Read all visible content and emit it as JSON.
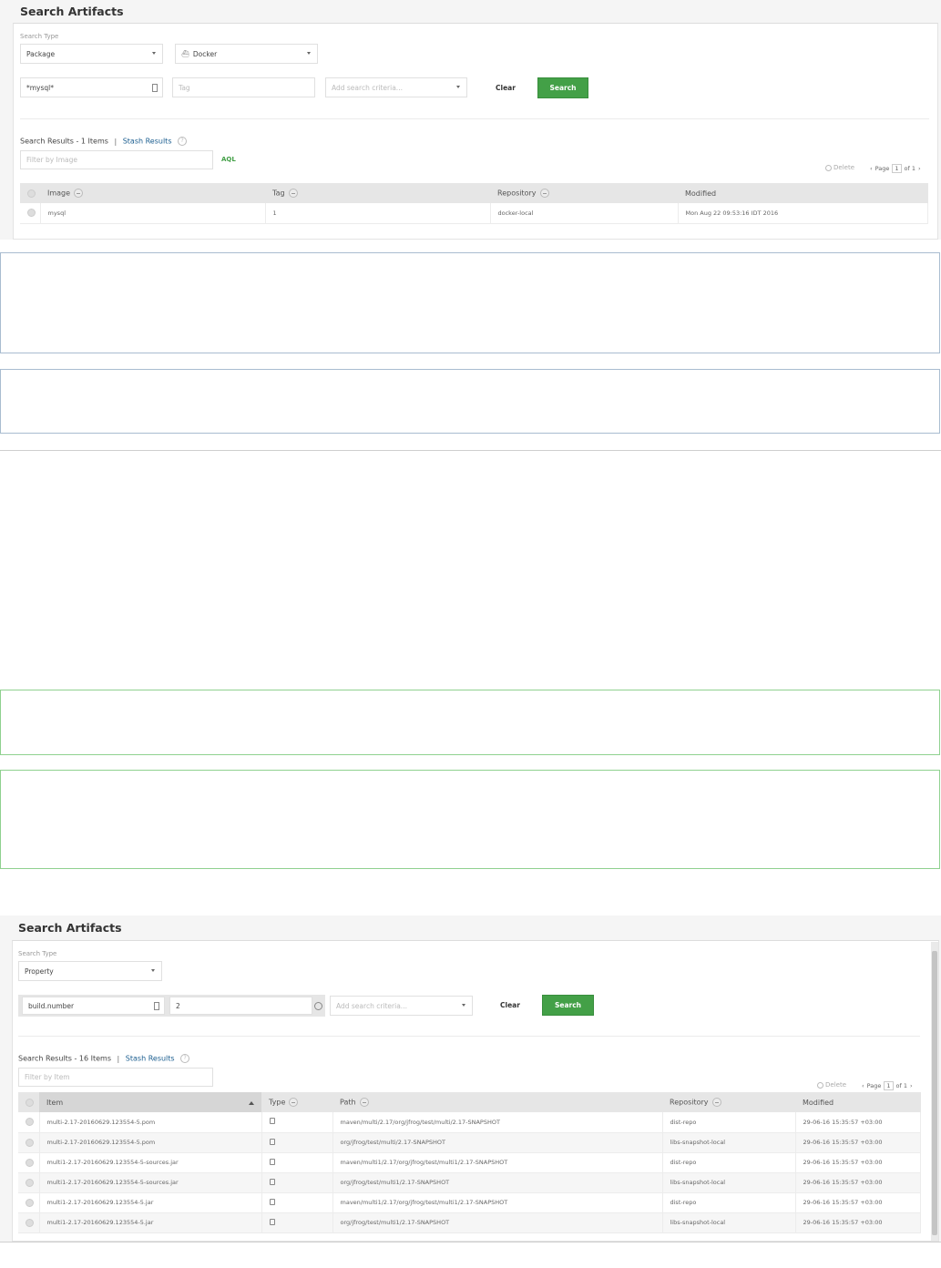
{
  "panel1": {
    "title": "Search Artifacts",
    "search_type_label": "Search Type",
    "search_type_value": "Package",
    "package_type_value": "Docker",
    "image_value": "*mysql*",
    "tag_placeholder": "Tag",
    "criteria_placeholder": "Add search criteria...",
    "clear_label": "Clear",
    "search_label": "Search",
    "results_label": "Search Results - 1 Items",
    "separator": "|",
    "stash_label": "Stash Results",
    "help": "?",
    "filter_placeholder": "Filter by Image",
    "aql_label": "AQL",
    "delete_label": "Delete",
    "page_prefix": "Page",
    "page_number": "1",
    "page_suffix": "of 1",
    "columns": [
      "Image",
      "Tag",
      "Repository",
      "Modified"
    ],
    "rows": [
      {
        "image": "mysql",
        "tag": "1",
        "repository": "docker-local",
        "modified": "Mon Aug 22 09:53:16 IDT 2016"
      }
    ]
  },
  "panel2": {
    "title": "Search Artifacts",
    "search_type_label": "Search Type",
    "search_type_value": "Property",
    "property_key": "build.number",
    "property_value": "2",
    "criteria_placeholder": "Add search criteria...",
    "clear_label": "Clear",
    "search_label": "Search",
    "results_label": "Search Results - 16 Items",
    "separator": "|",
    "stash_label": "Stash Results",
    "help": "?",
    "filter_placeholder": "Filter by Item",
    "delete_label": "Delete",
    "page_prefix": "Page",
    "page_number": "1",
    "page_suffix": "of 1",
    "columns": [
      "Item",
      "Type",
      "Path",
      "Repository",
      "Modified"
    ],
    "rows": [
      {
        "item": "multi-2.17-20160629.123554-5.pom",
        "path": "maven/multi/2.17/org/jfrog/test/multi/2.17-SNAPSHOT",
        "repository": "dist-repo",
        "modified": "29-06-16 15:35:57 +03:00"
      },
      {
        "item": "multi-2.17-20160629.123554-5.pom",
        "path": "org/jfrog/test/multi/2.17-SNAPSHOT",
        "repository": "libs-snapshot-local",
        "modified": "29-06-16 15:35:57 +03:00"
      },
      {
        "item": "multi1-2.17-20160629.123554-5-sources.jar",
        "path": "maven/multi1/2.17/org/jfrog/test/multi1/2.17-SNAPSHOT",
        "repository": "dist-repo",
        "modified": "29-06-16 15:35:57 +03:00"
      },
      {
        "item": "multi1-2.17-20160629.123554-5-sources.jar",
        "path": "org/jfrog/test/multi1/2.17-SNAPSHOT",
        "repository": "libs-snapshot-local",
        "modified": "29-06-16 15:35:57 +03:00"
      },
      {
        "item": "multi1-2.17-20160629.123554-5.jar",
        "path": "maven/multi1/2.17/org/jfrog/test/multi1/2.17-SNAPSHOT",
        "repository": "dist-repo",
        "modified": "29-06-16 15:35:57 +03:00"
      },
      {
        "item": "multi1-2.17-20160629.123554-5.jar",
        "path": "org/jfrog/test/multi1/2.17-SNAPSHOT",
        "repository": "libs-snapshot-local",
        "modified": "29-06-16 15:35:57 +03:00"
      }
    ]
  },
  "colors": {
    "accent_green": "#43a047",
    "link_blue": "#1a5d8f",
    "note_blue_border": "#a9bcd0",
    "note_green_border": "#8fd18f"
  }
}
